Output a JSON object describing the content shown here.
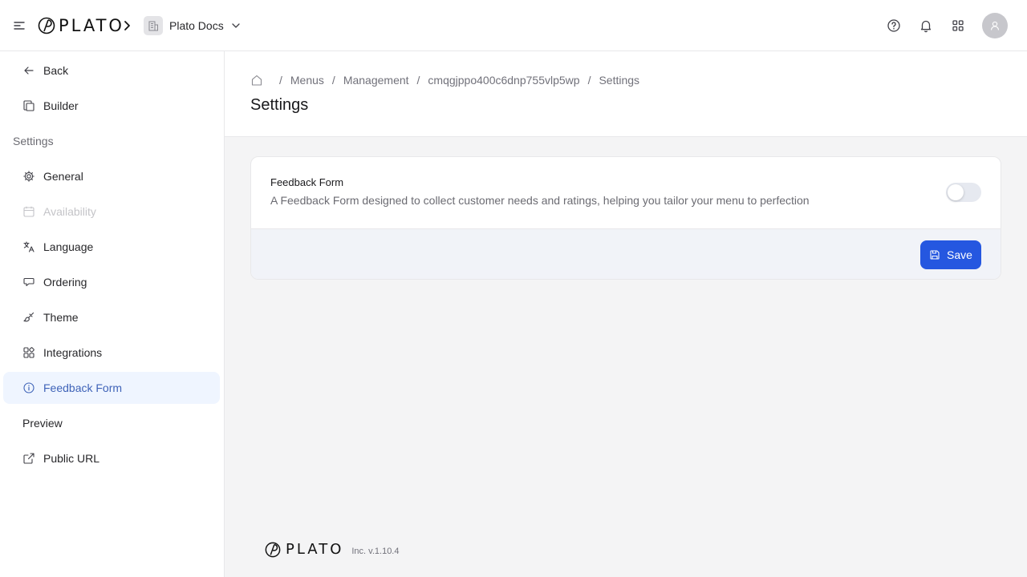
{
  "app": {
    "brand": "PLATO",
    "workspace": "Plato Docs"
  },
  "sidebar": {
    "back": "Back",
    "builder": "Builder",
    "settings_section": "Settings",
    "items": [
      {
        "label": "General",
        "icon": "gear-icon"
      },
      {
        "label": "Availability",
        "icon": "calendar-icon",
        "disabled": true
      },
      {
        "label": "Language",
        "icon": "translate-icon"
      },
      {
        "label": "Ordering",
        "icon": "chat-icon"
      },
      {
        "label": "Theme",
        "icon": "brush-icon"
      },
      {
        "label": "Integrations",
        "icon": "integrations-icon"
      },
      {
        "label": "Feedback Form",
        "icon": "info-icon",
        "active": true
      }
    ],
    "preview_section": "Preview",
    "public_url": "Public URL"
  },
  "breadcrumb": [
    "Menus",
    "Management",
    "cmqgjppo400c6dnp755vlp5wp",
    "Settings"
  ],
  "page": {
    "title": "Settings"
  },
  "feedback_card": {
    "title": "Feedback Form",
    "description": "A Feedback Form designed to collect customer needs and ratings, helping you tailor your menu to perfection",
    "enabled": false,
    "save_label": "Save"
  },
  "footer": {
    "brand": "PLATO",
    "version": "Inc. v.1.10.4"
  },
  "colors": {
    "accent": "#2557e0",
    "active_bg": "#eff5ff",
    "active_text": "#3f63b8"
  }
}
